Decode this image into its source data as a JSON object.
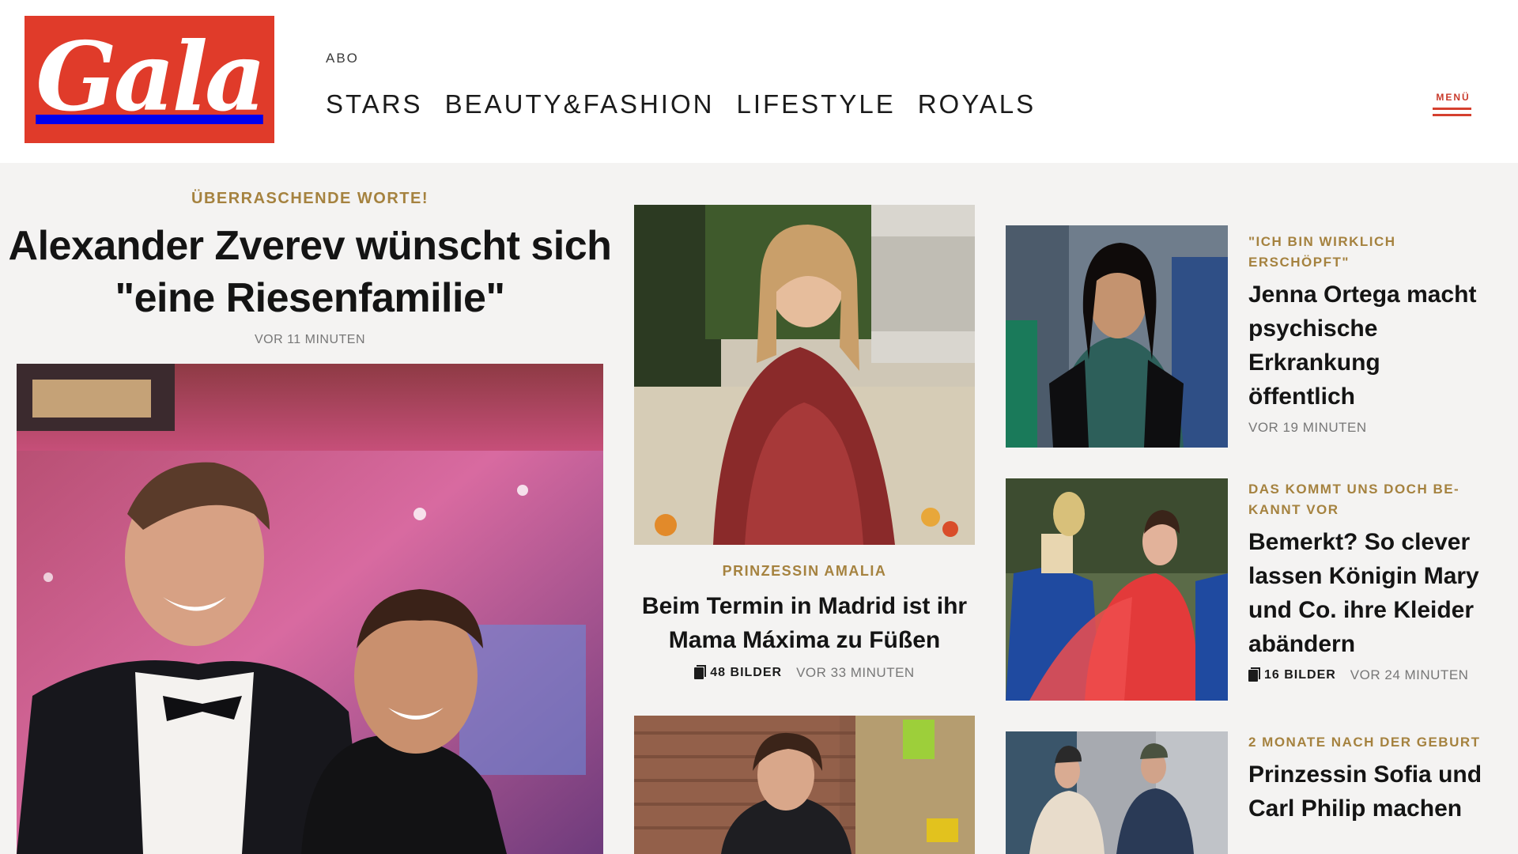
{
  "header": {
    "logo_text": "Gala",
    "abo": "ABO",
    "nav": [
      "STARS",
      "BEAUTY&FASHION",
      "LIFESTYLE",
      "ROYALS"
    ],
    "menu_label": "MENÜ"
  },
  "lead": {
    "kicker": "ÜBERRASCHENDE WORTE!",
    "title": "Alexander Zverev wünscht sich \"eine Riesenfamilie\"",
    "time": "VOR 11 MINUTEN"
  },
  "middle": {
    "article1": {
      "kicker": "PRINZESSIN AMALIA",
      "title": "Beim Termin in Madrid ist ihr Mama Máxima zu Füßen",
      "gallery": "48 BILDER",
      "time": "VOR 33 MINUTEN"
    }
  },
  "right": {
    "articles": [
      {
        "kicker": "\"ICH BIN WIRKLICH ERSCHÖPFT\"",
        "title": "Jenna Ortega macht psychische Erkrankung öffentlich",
        "gallery": "",
        "time": "VOR 19 MINUTEN"
      },
      {
        "kicker": "DAS KOMMT UNS DOCH BE-KANNT VOR",
        "title": "Bemerkt? So clever lassen Königin Mary und Co. ihre Kleider abändern",
        "gallery": "16 BILDER",
        "time": "VOR 24 MINUTEN"
      },
      {
        "kicker": "2 MONATE NACH DER GEBURT",
        "title": "Prinzessin Sofia und Carl Philip machen",
        "gallery": "",
        "time": ""
      }
    ]
  },
  "colors": {
    "brand_red": "#e03b2a",
    "kicker_gold": "#a5823f",
    "background": "#f4f3f2"
  }
}
